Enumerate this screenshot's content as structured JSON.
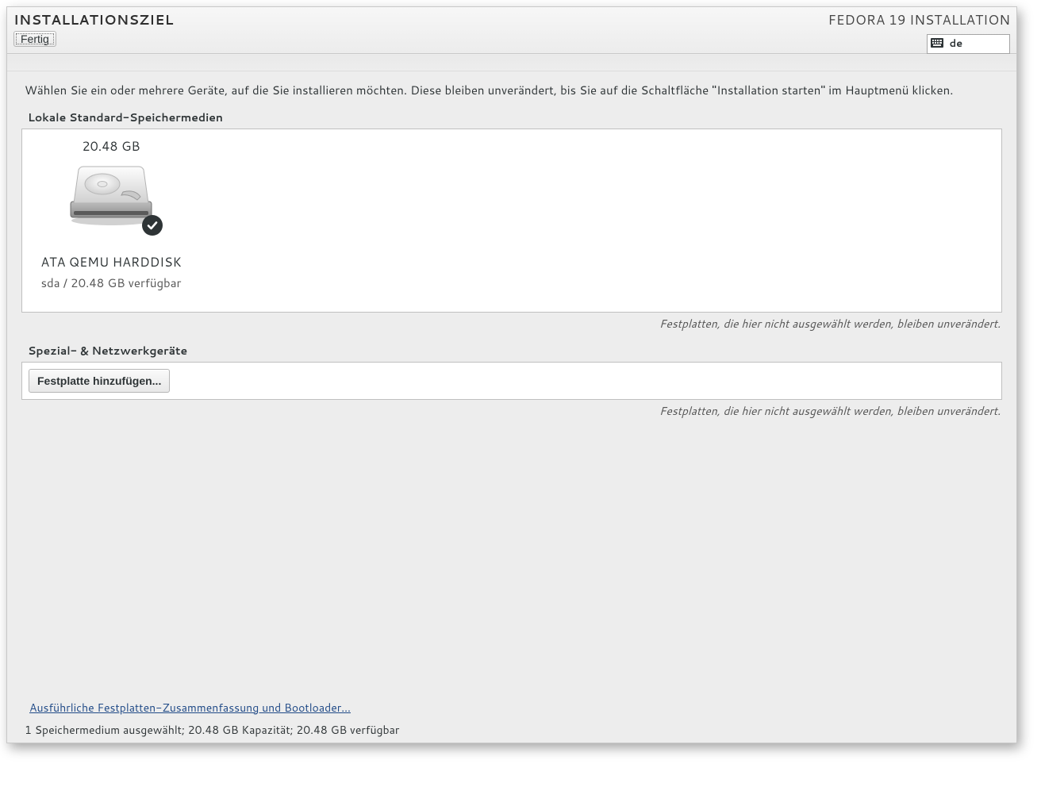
{
  "header": {
    "title": "INSTALLATIONSZIEL",
    "done_label": "Fertig",
    "installer_label": "FEDORA 19 INSTALLATION",
    "keyboard_layout": "de"
  },
  "intro": "Wählen Sie ein oder mehrere Geräte, auf die Sie installieren möchten. Diese bleiben unverändert, bis Sie auf die Schaltfläche \"Installation starten\" im Hauptmenü klicken.",
  "sections": {
    "local_title": "Lokale Standard-Speichermedien",
    "network_title": "Spezial- & Netzwerkgeräte",
    "unchanged_note": "Festplatten, die hier nicht ausgewählt werden, bleiben unverändert."
  },
  "disk": {
    "size": "20.48 GB",
    "name": "ATA QEMU HARDDISK",
    "sub": "sda / 20.48 GB verfügbar"
  },
  "add_disk_label": "Festplatte hinzufügen...",
  "footer": {
    "summary_link": "Ausführliche Festplatten-Zusammenfassung und Bootloader...",
    "status": "1 Speichermedium ausgewählt; 20.48 GB Kapazität; 20.48 GB verfügbar"
  }
}
